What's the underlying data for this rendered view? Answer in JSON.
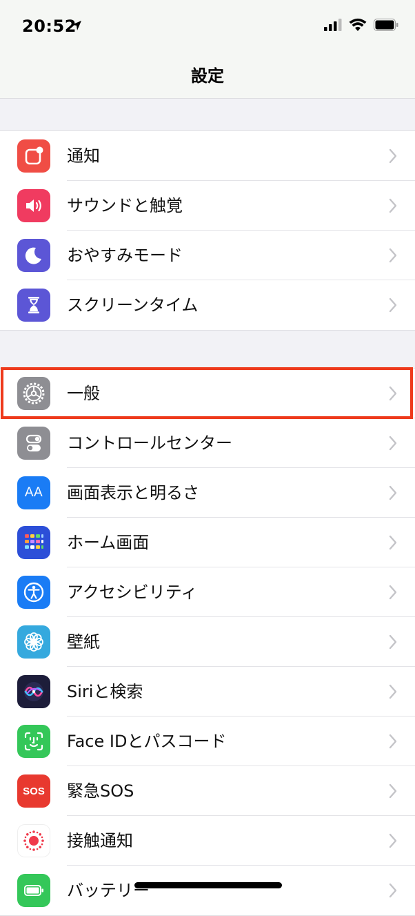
{
  "status_bar": {
    "time": "20:52"
  },
  "nav": {
    "title": "設定"
  },
  "group1": [
    {
      "label": "通知",
      "icon": "notifications-icon",
      "color": "#f04d45"
    },
    {
      "label": "サウンドと触覚",
      "icon": "sounds-icon",
      "color": "#f03b60"
    },
    {
      "label": "おやすみモード",
      "icon": "moon-icon",
      "color": "#5c56d6"
    },
    {
      "label": "スクリーンタイム",
      "icon": "hourglass-icon",
      "color": "#5c56d6"
    }
  ],
  "group2": [
    {
      "label": "一般",
      "icon": "gear-icon",
      "color": "#8e8e93"
    },
    {
      "label": "コントロールセンター",
      "icon": "toggles-icon",
      "color": "#8e8e93"
    },
    {
      "label": "画面表示と明るさ",
      "icon": "text-size-icon",
      "color": "#1a7cf5",
      "glyph": "AA"
    },
    {
      "label": "ホーム画面",
      "icon": "app-grid-icon",
      "color": "#2c4fd8"
    },
    {
      "label": "アクセシビリティ",
      "icon": "accessibility-icon",
      "color": "#1a7cf5"
    },
    {
      "label": "壁紙",
      "icon": "flower-icon",
      "color": "#35a9de"
    },
    {
      "label": "Siriと検索",
      "icon": "siri-icon",
      "color": "#1d1d3a"
    },
    {
      "label": "Face IDとパスコード",
      "icon": "face-id-icon",
      "color": "#34c759"
    },
    {
      "label": "緊急SOS",
      "icon": "sos-icon",
      "color": "#e8392f",
      "glyph": "SOS"
    },
    {
      "label": "接触通知",
      "icon": "exposure-icon",
      "color": "#ffffff"
    },
    {
      "label": "バッテリー",
      "icon": "battery-icon",
      "color": "#34c759"
    }
  ],
  "highlight_color": "#ee3a1c"
}
